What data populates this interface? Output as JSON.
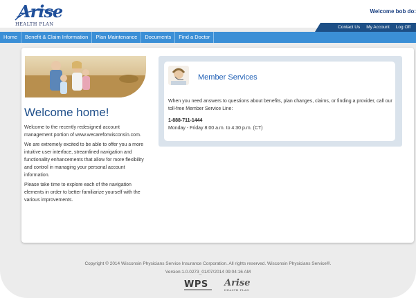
{
  "header": {
    "logo_script": "Arise",
    "logo_sub": "HEALTH PLAN",
    "welcome_user": "Welcome bob do:",
    "util_links": [
      "Contact Us",
      "My Account",
      "Log Off"
    ]
  },
  "nav": {
    "items": [
      "Home",
      "Benefit & Claim Information",
      "Plan Maintenance",
      "Documents",
      "Find a Doctor"
    ]
  },
  "main": {
    "welcome_title": "Welcome home!",
    "paragraphs": [
      "Welcome to the recently redesigned account management portion of www.wecareforwisconsin.com.",
      "We are extremely excited to be able to offer you a more intuitive user interface, streamlined navigation and functionality enhancements that allow for more flexibility and control in managing your personal account information.",
      "Please take time to explore each of the navigation elements in order to better familiarize yourself with the various improvements."
    ]
  },
  "member_services": {
    "title": "Member Services",
    "description": "When you need answers to questions about benefits, plan changes, claims, or finding a provider, call our toll-free Member Service Line:",
    "phone": "1-888-711-1444",
    "hours": "Monday - Friday 8:00 a.m. to 4:30 p.m. (CT)"
  },
  "footer": {
    "copyright": "Copyright © 2014 Wisconsin Physicians Service Insurance Corporation. All rights reserved. Wisconsin Physicians Service®.",
    "version": "Version:1.0.0273_01/07/2014 09:04:16 AM",
    "wps_logo": "WPS",
    "arise_logo_script": "Arise",
    "arise_logo_sub": "HEALTH PLAN"
  },
  "colors": {
    "nav_blue": "#3b8fd6",
    "util_bar_blue": "#1d4f86",
    "brand_blue": "#1f4f9a",
    "panel_gray": "#dae3ec"
  }
}
